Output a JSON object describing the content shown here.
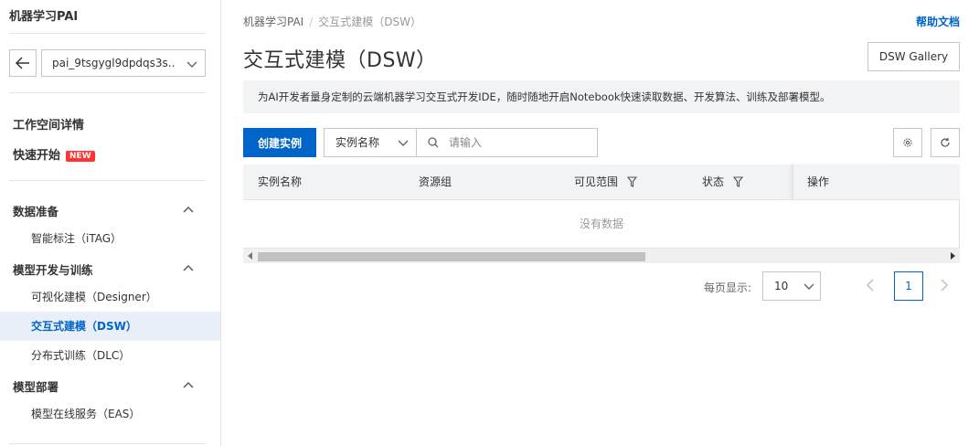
{
  "sidebar": {
    "app_title": "机器学习PAI",
    "workspace": "pai_9tsgygl9dpdqs3s...",
    "top_items": [
      {
        "label": "工作空间详情"
      },
      {
        "label": "快速开始",
        "badge": "NEW"
      }
    ],
    "groups": [
      {
        "label": "数据准备",
        "items": [
          "智能标注（iTAG）"
        ]
      },
      {
        "label": "模型开发与训练",
        "items": [
          "可视化建模（Designer）",
          "交互式建模（DSW）",
          "分布式训练（DLC）"
        ]
      },
      {
        "label": "模型部署",
        "items": [
          "模型在线服务（EAS）"
        ]
      }
    ],
    "active_item": "交互式建模（DSW）"
  },
  "header": {
    "breadcrumb": [
      "机器学习PAI",
      "交互式建模（DSW）"
    ],
    "help_link": "帮助文档",
    "title": "交互式建模（DSW）",
    "gallery_button": "DSW Gallery"
  },
  "notice": "为AI开发者量身定制的云端机器学习交互式开发IDE，随时随地开启Notebook快速读取数据、开发算法、训练及部署模型。",
  "toolbar": {
    "create_button": "创建实例",
    "filter_field": "实例名称",
    "search_placeholder": "请输入",
    "settings_icon": "gear-icon",
    "refresh_icon": "refresh-icon"
  },
  "table": {
    "columns": [
      "实例名称",
      "资源组",
      "可见范围",
      "状态",
      "操作"
    ],
    "empty_text": "没有数据",
    "rows": []
  },
  "pagination": {
    "page_size_label": "每页显示:",
    "page_size": "10",
    "current_page": "1"
  },
  "colors": {
    "primary": "#0064c8",
    "new_badge": "#ff3333",
    "active_nav_bg": "#e9eff8"
  }
}
